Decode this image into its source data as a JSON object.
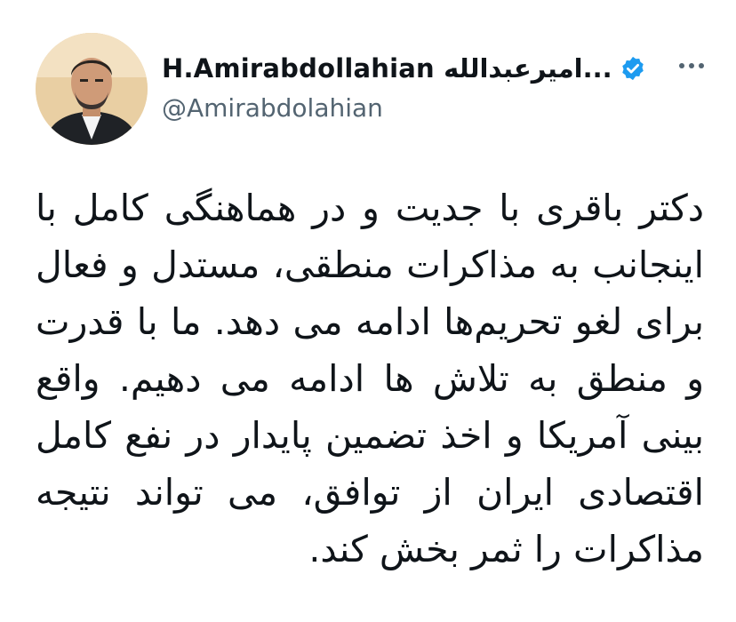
{
  "author": {
    "display_name": "H.Amirabdollahian امیرعبدالله...",
    "handle": "@Amirabdolahian",
    "verified": true,
    "avatar_icon": "portrait-avatar"
  },
  "more_icon": "ellipsis-icon",
  "tweet": {
    "text": "دکتر باقری با جدیت و در هماهنگی کامل با اینجانب به مذاکرات منطقی، مستدل و فعال برای لغو تحریم‌ها ادامه می دهد. ما با قدرت و منطق به تلاش ها ادامه می دهیم. واقع بینی آمریکا و اخذ تضمین پایدار  در نفع کامل اقتصادی ایران از توافق، می تواند نتیجه مذاکرات را ثمر بخش کند."
  },
  "colors": {
    "text": "#0f1419",
    "secondary": "#536471",
    "verified_blue": "#1d9bf0"
  }
}
